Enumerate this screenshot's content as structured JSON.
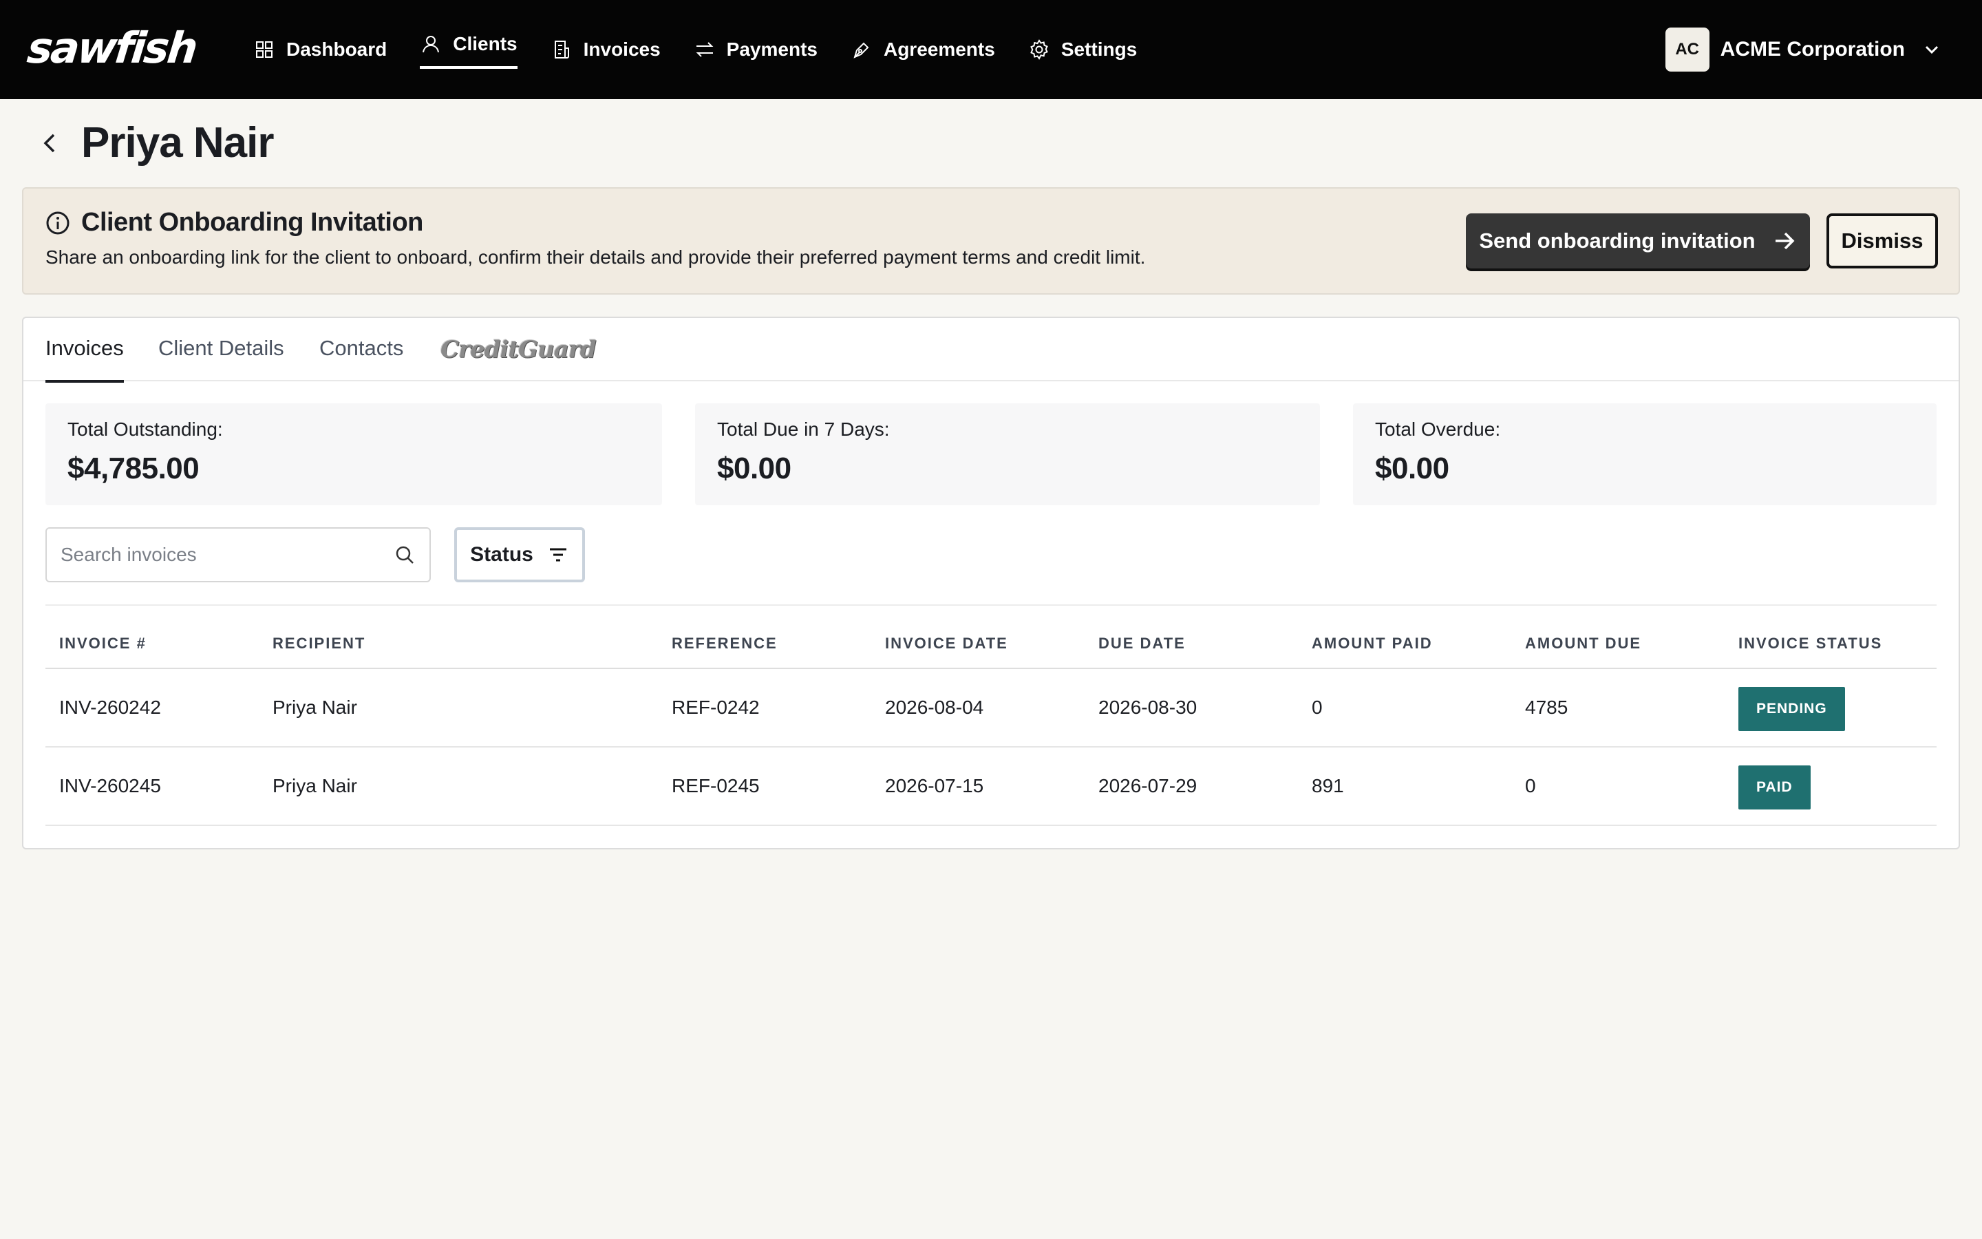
{
  "brand": {
    "logo_text": "sawfish"
  },
  "nav": {
    "items": [
      {
        "label": "Dashboard",
        "icon": "grid-icon"
      },
      {
        "label": "Clients",
        "icon": "person-icon",
        "active": true
      },
      {
        "label": "Invoices",
        "icon": "invoice-icon"
      },
      {
        "label": "Payments",
        "icon": "arrows-icon"
      },
      {
        "label": "Agreements",
        "icon": "pen-icon"
      },
      {
        "label": "Settings",
        "icon": "gear-icon"
      }
    ]
  },
  "org": {
    "initials": "AC",
    "name": "ACME Corporation"
  },
  "page": {
    "title": "Priya Nair"
  },
  "banner": {
    "title": "Client Onboarding Invitation",
    "text": "Share an onboarding link for the client to onboard, confirm their details and provide their preferred payment terms and credit limit.",
    "send_label": "Send onboarding invitation",
    "dismiss_label": "Dismiss"
  },
  "tabs": [
    {
      "label": "Invoices",
      "active": true
    },
    {
      "label": "Client Details"
    },
    {
      "label": "Contacts"
    }
  ],
  "tab_logo": "CreditGuard",
  "stats": [
    {
      "label": "Total Outstanding:",
      "value": "$4,785.00"
    },
    {
      "label": "Total Due in 7 Days:",
      "value": "$0.00"
    },
    {
      "label": "Total Overdue:",
      "value": "$0.00"
    }
  ],
  "search": {
    "placeholder": "Search invoices",
    "value": ""
  },
  "filter": {
    "label": "Status"
  },
  "table": {
    "columns": [
      "INVOICE #",
      "RECIPIENT",
      "REFERENCE",
      "INVOICE DATE",
      "DUE DATE",
      "AMOUNT PAID",
      "AMOUNT DUE",
      "INVOICE STATUS"
    ],
    "rows": [
      [
        "INV-260242",
        "Priya Nair",
        "REF-0242",
        "2026-08-04",
        "2026-08-30",
        "0",
        "4785",
        "PENDING"
      ],
      [
        "INV-260245",
        "Priya Nair",
        "REF-0245",
        "2026-07-15",
        "2026-07-29",
        "891",
        "0",
        "PAID"
      ]
    ]
  },
  "colors": {
    "topbar": "#050505",
    "banner_bg": "#f1ebe1",
    "status_badge": "#1f7070",
    "primary_button": "#363636"
  }
}
